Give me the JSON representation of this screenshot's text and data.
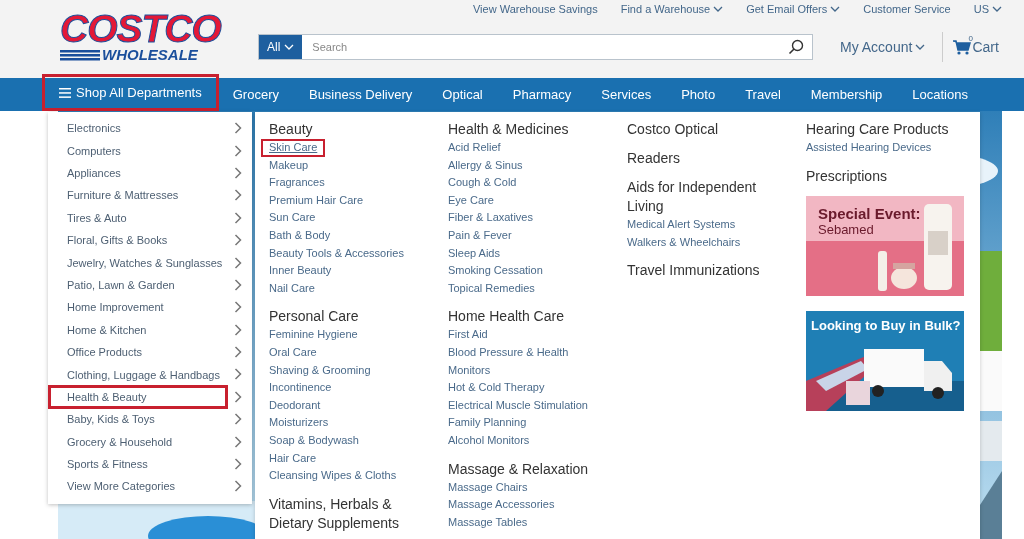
{
  "logo": {
    "line_1": "COSTCO",
    "line_2": "WHOLESALE"
  },
  "top_links": [
    {
      "label": "View Warehouse Savings",
      "dropdown": false
    },
    {
      "label": "Find a Warehouse",
      "dropdown": true
    },
    {
      "label": "Get Email Offers",
      "dropdown": true
    },
    {
      "label": "Customer Service",
      "dropdown": false
    },
    {
      "label": "US",
      "dropdown": true
    }
  ],
  "search": {
    "scope": "All",
    "placeholder": "Search"
  },
  "account": {
    "label": "My Account"
  },
  "cart": {
    "label": "Cart",
    "count": "0"
  },
  "nav": [
    {
      "label": "Shop All Departments",
      "kind": "menu",
      "highlighted": true
    },
    {
      "label": "Grocery",
      "kind": "link",
      "highlighted": false
    },
    {
      "label": "Business Delivery",
      "kind": "link",
      "highlighted": false
    },
    {
      "label": "Optical",
      "kind": "link",
      "highlighted": false
    },
    {
      "label": "Pharmacy",
      "kind": "link",
      "highlighted": false
    },
    {
      "label": "Services",
      "kind": "link",
      "highlighted": false
    },
    {
      "label": "Photo",
      "kind": "link",
      "highlighted": false
    },
    {
      "label": "Travel",
      "kind": "link",
      "highlighted": false
    },
    {
      "label": "Membership",
      "kind": "link",
      "highlighted": false
    },
    {
      "label": "Locations",
      "kind": "link",
      "highlighted": false
    }
  ],
  "categories": [
    {
      "label": "Electronics",
      "highlighted": false
    },
    {
      "label": "Computers",
      "highlighted": false
    },
    {
      "label": "Appliances",
      "highlighted": false
    },
    {
      "label": "Furniture & Mattresses",
      "highlighted": false
    },
    {
      "label": "Tires & Auto",
      "highlighted": false
    },
    {
      "label": "Floral, Gifts & Books",
      "highlighted": false
    },
    {
      "label": "Jewelry, Watches & Sunglasses",
      "highlighted": false
    },
    {
      "label": "Patio, Lawn & Garden",
      "highlighted": false
    },
    {
      "label": "Home Improvement",
      "highlighted": false
    },
    {
      "label": "Home & Kitchen",
      "highlighted": false
    },
    {
      "label": "Office Products",
      "highlighted": false
    },
    {
      "label": "Clothing, Luggage & Handbags",
      "highlighted": false
    },
    {
      "label": "Health & Beauty",
      "highlighted": true
    },
    {
      "label": "Baby, Kids & Toys",
      "highlighted": false
    },
    {
      "label": "Grocery & Household",
      "highlighted": false
    },
    {
      "label": "Sports & Fitness",
      "highlighted": false
    },
    {
      "label": "View More Categories",
      "highlighted": false
    }
  ],
  "submenu": {
    "columns": [
      {
        "groups": [
          {
            "heading": "Beauty",
            "links": [
              {
                "label": "Skin Care",
                "highlighted": true
              },
              {
                "label": "Makeup",
                "highlighted": false
              },
              {
                "label": "Fragrances",
                "highlighted": false
              },
              {
                "label": "Premium Hair Care",
                "highlighted": false
              },
              {
                "label": "Sun Care",
                "highlighted": false
              },
              {
                "label": "Bath & Body",
                "highlighted": false
              },
              {
                "label": "Beauty Tools & Accessories",
                "highlighted": false
              },
              {
                "label": "Inner Beauty",
                "highlighted": false
              },
              {
                "label": "Nail Care",
                "highlighted": false
              }
            ]
          },
          {
            "heading": "Personal Care",
            "links": [
              {
                "label": "Feminine Hygiene",
                "highlighted": false
              },
              {
                "label": "Oral Care",
                "highlighted": false
              },
              {
                "label": "Shaving & Grooming",
                "highlighted": false
              },
              {
                "label": "Incontinence",
                "highlighted": false
              },
              {
                "label": "Deodorant",
                "highlighted": false
              },
              {
                "label": "Moisturizers",
                "highlighted": false
              },
              {
                "label": "Soap & Bodywash",
                "highlighted": false
              },
              {
                "label": "Hair Care",
                "highlighted": false
              },
              {
                "label": "Cleansing Wipes & Cloths",
                "highlighted": false
              }
            ]
          },
          {
            "heading": "Vitamins, Herbals & Dietary Supplements"
          }
        ]
      },
      {
        "groups": [
          {
            "heading": "Health & Medicines",
            "links": [
              {
                "label": "Acid Relief",
                "highlighted": false
              },
              {
                "label": "Allergy & Sinus",
                "highlighted": false
              },
              {
                "label": "Cough & Cold",
                "highlighted": false
              },
              {
                "label": "Eye Care",
                "highlighted": false
              },
              {
                "label": "Fiber & Laxatives",
                "highlighted": false
              },
              {
                "label": "Pain & Fever",
                "highlighted": false
              },
              {
                "label": "Sleep Aids",
                "highlighted": false
              },
              {
                "label": "Smoking Cessation",
                "highlighted": false
              },
              {
                "label": "Topical Remedies",
                "highlighted": false
              }
            ]
          },
          {
            "heading": "Home Health Care",
            "links": [
              {
                "label": "First Aid",
                "highlighted": false
              },
              {
                "label": "Blood Pressure & Health",
                "highlighted": false
              },
              {
                "label": "Monitors",
                "highlighted": false
              },
              {
                "label": "Hot & Cold Therapy",
                "highlighted": false
              },
              {
                "label": "Electrical Muscle Stimulation",
                "highlighted": false
              },
              {
                "label": "Family Planning",
                "highlighted": false
              },
              {
                "label": "Alcohol Monitors",
                "highlighted": false
              }
            ]
          },
          {
            "heading": "Massage & Relaxation",
            "links": [
              {
                "label": "Massage Chairs",
                "highlighted": false
              },
              {
                "label": "Massage Accessories",
                "highlighted": false
              },
              {
                "label": "Massage Tables",
                "highlighted": false
              }
            ]
          }
        ]
      },
      {
        "groups": [
          {
            "heading": "Costco Optical"
          },
          {
            "heading": "Readers"
          },
          {
            "heading": "Aids for Independent Living",
            "links": [
              {
                "label": "Medical Alert Systems",
                "highlighted": false
              },
              {
                "label": "Walkers & Wheelchairs",
                "highlighted": false
              }
            ]
          },
          {
            "heading": "Travel Immunizations"
          }
        ]
      },
      {
        "groups": [
          {
            "heading": "Hearing Care Products",
            "links": [
              {
                "label": "Assisted Hearing Devices",
                "highlighted": false
              }
            ]
          },
          {
            "heading": "Prescriptions"
          }
        ],
        "promos": [
          {
            "kind": "products",
            "title": "Special Event:",
            "subtitle": "Sebamed"
          },
          {
            "kind": "truck",
            "title": "Looking to Buy in Bulk?"
          }
        ]
      }
    ]
  }
}
